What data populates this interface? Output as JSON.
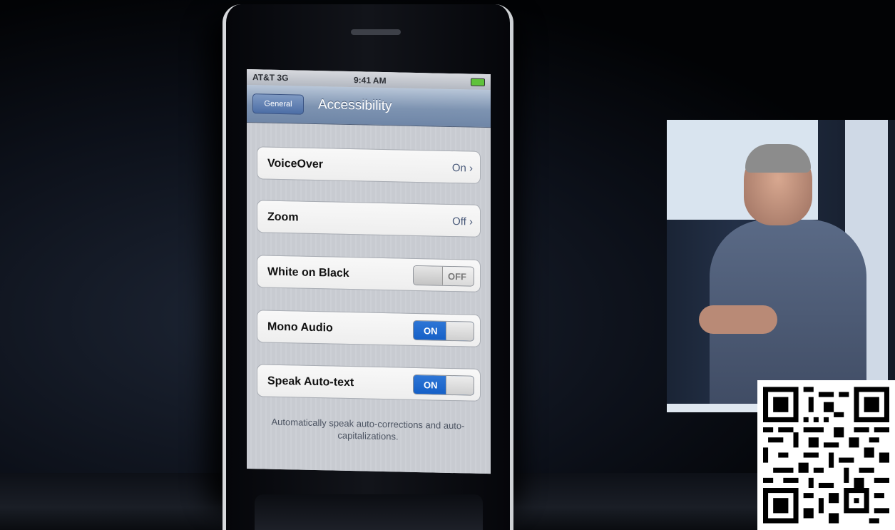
{
  "status_bar": {
    "carrier": "AT&T 3G",
    "time": "9:41 AM"
  },
  "nav_bar": {
    "back_label": "General",
    "title": "Accessibility"
  },
  "settings": {
    "voiceover": {
      "label": "VoiceOver",
      "value": "On ›"
    },
    "zoom": {
      "label": "Zoom",
      "value": "Off ›"
    },
    "white_on_black": {
      "label": "White on Black",
      "toggle": "OFF"
    },
    "mono_audio": {
      "label": "Mono Audio",
      "toggle": "ON"
    },
    "speak_auto_text": {
      "label": "Speak Auto-text",
      "toggle": "ON"
    }
  },
  "footer_note": "Automatically speak auto-corrections and auto-capitalizations.",
  "colors": {
    "toggle_on": "#1a66cc",
    "nav_bar": "#7d93b1"
  }
}
